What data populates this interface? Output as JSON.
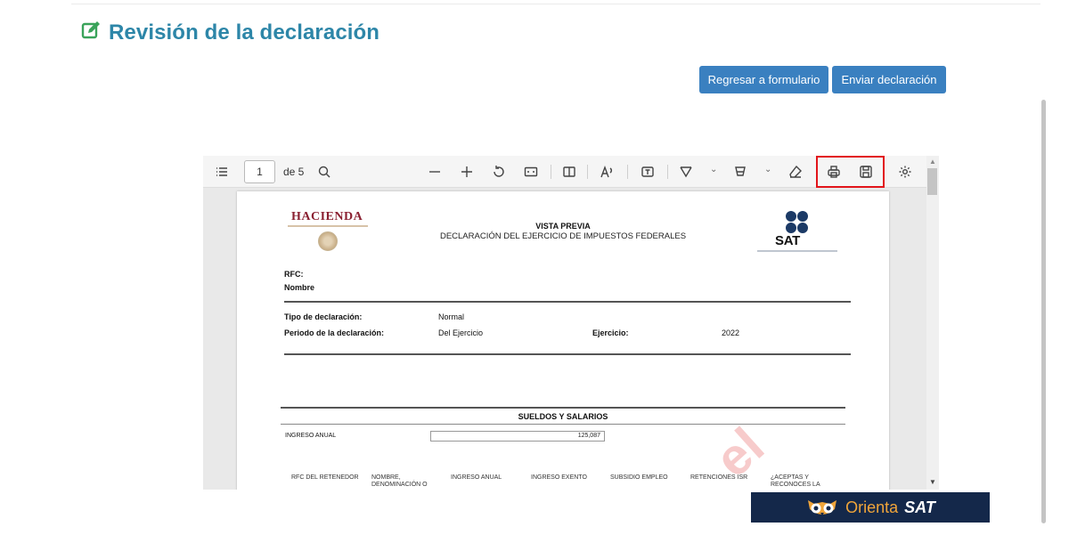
{
  "page": {
    "title": "Revisión de la declaración",
    "title_icon": "edit-icon",
    "accent_color": "#2d86a8"
  },
  "actions": {
    "back_label": "Regresar a formulario",
    "send_label": "Enviar declaración",
    "button_color": "#3a80c0"
  },
  "viewer": {
    "page_number": "1",
    "page_total": "de 5",
    "highlight_color": "#e2141a",
    "toolbar_icons": [
      "toc-icon",
      "search-icon",
      "zoom-out-icon",
      "zoom-in-icon",
      "rotate-icon",
      "fit-width-icon",
      "two-page-icon",
      "read-aloud-icon",
      "text-box-icon",
      "draw-icon",
      "highlight-icon",
      "eraser-icon",
      "print-icon",
      "save-icon",
      "settings-icon"
    ]
  },
  "document": {
    "brand_left": "HACIENDA",
    "heading_1": "VISTA PREVIA",
    "heading_2": "DECLARACIÓN DEL EJERCICIO DE IMPUESTOS FEDERALES",
    "brand_right": "SAT",
    "rfc_label": "RFC:",
    "nombre_label": "Nombre",
    "tipo_label": "Tipo de declaración:",
    "tipo_value": "Normal",
    "periodo_label": "Periodo de la declaración:",
    "periodo_value": "Del Ejercicio",
    "ejercicio_label": "Ejercicio:",
    "ejercicio_value": "2022",
    "section_title": "SUELDOS Y SALARIOS",
    "ingreso_label": "INGRESO ANUAL",
    "ingreso_value": "125,087",
    "columns": [
      "RFC DEL RETENEDOR",
      "NOMBRE, DENOMINACIÓN O",
      "INGRESO ANUAL",
      "INGRESO EXENTO",
      "SUBSIDIO EMPLEO",
      "RETENCIONES ISR",
      "¿ACEPTAS Y RECONOCES LA"
    ]
  },
  "badge": {
    "part_1": "Orienta",
    "part_2": "SAT"
  }
}
